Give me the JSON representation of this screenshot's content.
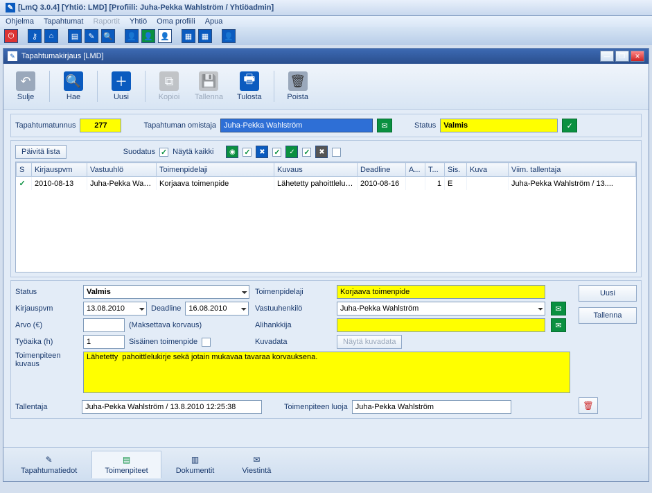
{
  "window": {
    "title": "[LmQ 3.0.4]   [Yhtiö: LMD]   [Profiili: Juha-Pekka Wahlström / Yhtiöadmin]"
  },
  "menu": {
    "ohjelma": "Ohjelma",
    "tapahtumat": "Tapahtumat",
    "raportit": "Raportit",
    "yhtio": "Yhtiö",
    "oma": "Oma profiili",
    "apua": "Apua"
  },
  "inner": {
    "title": "Tapahtumakirjaus [LMD]"
  },
  "bigbar": {
    "sulje": "Sulje",
    "hae": "Hae",
    "uusi": "Uusi",
    "kopioi": "Kopioi",
    "tallenna": "Tallenna",
    "tulosta": "Tulosta",
    "poista": "Poista"
  },
  "header": {
    "tunnus_label": "Tapahtumatunnus",
    "tunnus": "277",
    "omistaja_label": "Tapahtuman omistaja",
    "omistaja": "Juha-Pekka Wahlström",
    "status_label": "Status",
    "status": "Valmis"
  },
  "filters": {
    "paivita": "Päivitä lista",
    "suodatus": "Suodatus",
    "nayta": "Näytä kaikki"
  },
  "grid": {
    "cols": {
      "s": "S",
      "kirjauspvm": "Kirjauspvm",
      "vastuuhlo": "Vastuuhlö",
      "toimenpidelaji": "Toimenpidelaji",
      "kuvaus": "Kuvaus",
      "deadline": "Deadline",
      "a": "A...",
      "t": "T...",
      "sis": "Sis.",
      "kuva": "Kuva",
      "viim": "Viim. tallentaja"
    },
    "row": {
      "kirjauspvm": "2010-08-13",
      "vastuuhlo": "Juha-Pekka Wahl...",
      "toimenpidelaji": "Korjaava toimenpide",
      "kuvaus": "Lähetetty pahoittlelukir...",
      "deadline": "2010-08-16",
      "a": "",
      "t": "1",
      "sis": "E",
      "kuva": "",
      "viim": "Juha-Pekka Wahlström / 13...."
    }
  },
  "form": {
    "status_label": "Status",
    "status": "Valmis",
    "kirjauspvm_label": "Kirjauspvm",
    "kirjauspvm": "13.08.2010",
    "deadline_label": "Deadline",
    "deadline": "16.08.2010",
    "arvo_label": "Arvo (€)",
    "arvo": "",
    "arvo_note": "(Maksettava korvaus)",
    "tyoaika_label": "Työaika (h)",
    "tyoaika": "1",
    "sisainen_label": "Sisäinen toimenpide",
    "toimenpidelaji_label": "Toimenpidelaji",
    "toimenpidelaji": "Korjaava toimenpide",
    "vastuuhenkilo_label": "Vastuuhenkilö",
    "vastuuhenkilo": "Juha-Pekka Wahlström",
    "alihankkija_label": "Alihankkija",
    "alihankkija": "",
    "kuvadata_label": "Kuvadata",
    "kuvadata_btn": "Näytä kuvadata",
    "kuvaus_label": "Toimenpiteen kuvaus",
    "kuvaus": "Lähetetty  pahoittlelukirje sekä jotain mukavaa tavaraa korvauksena.",
    "tallentaja_label": "Tallentaja",
    "tallentaja": "Juha-Pekka Wahlström / 13.8.2010 12:25:38",
    "luoja_label": "Toimenpiteen luoja",
    "luoja": "Juha-Pekka Wahlström"
  },
  "side": {
    "uusi": "Uusi",
    "tallenna": "Tallenna"
  },
  "tabs": {
    "tapahtumatiedot": "Tapahtumatiedot",
    "toimenpiteet": "Toimenpiteet",
    "dokumentit": "Dokumentit",
    "viestinta": "Viestintä"
  }
}
